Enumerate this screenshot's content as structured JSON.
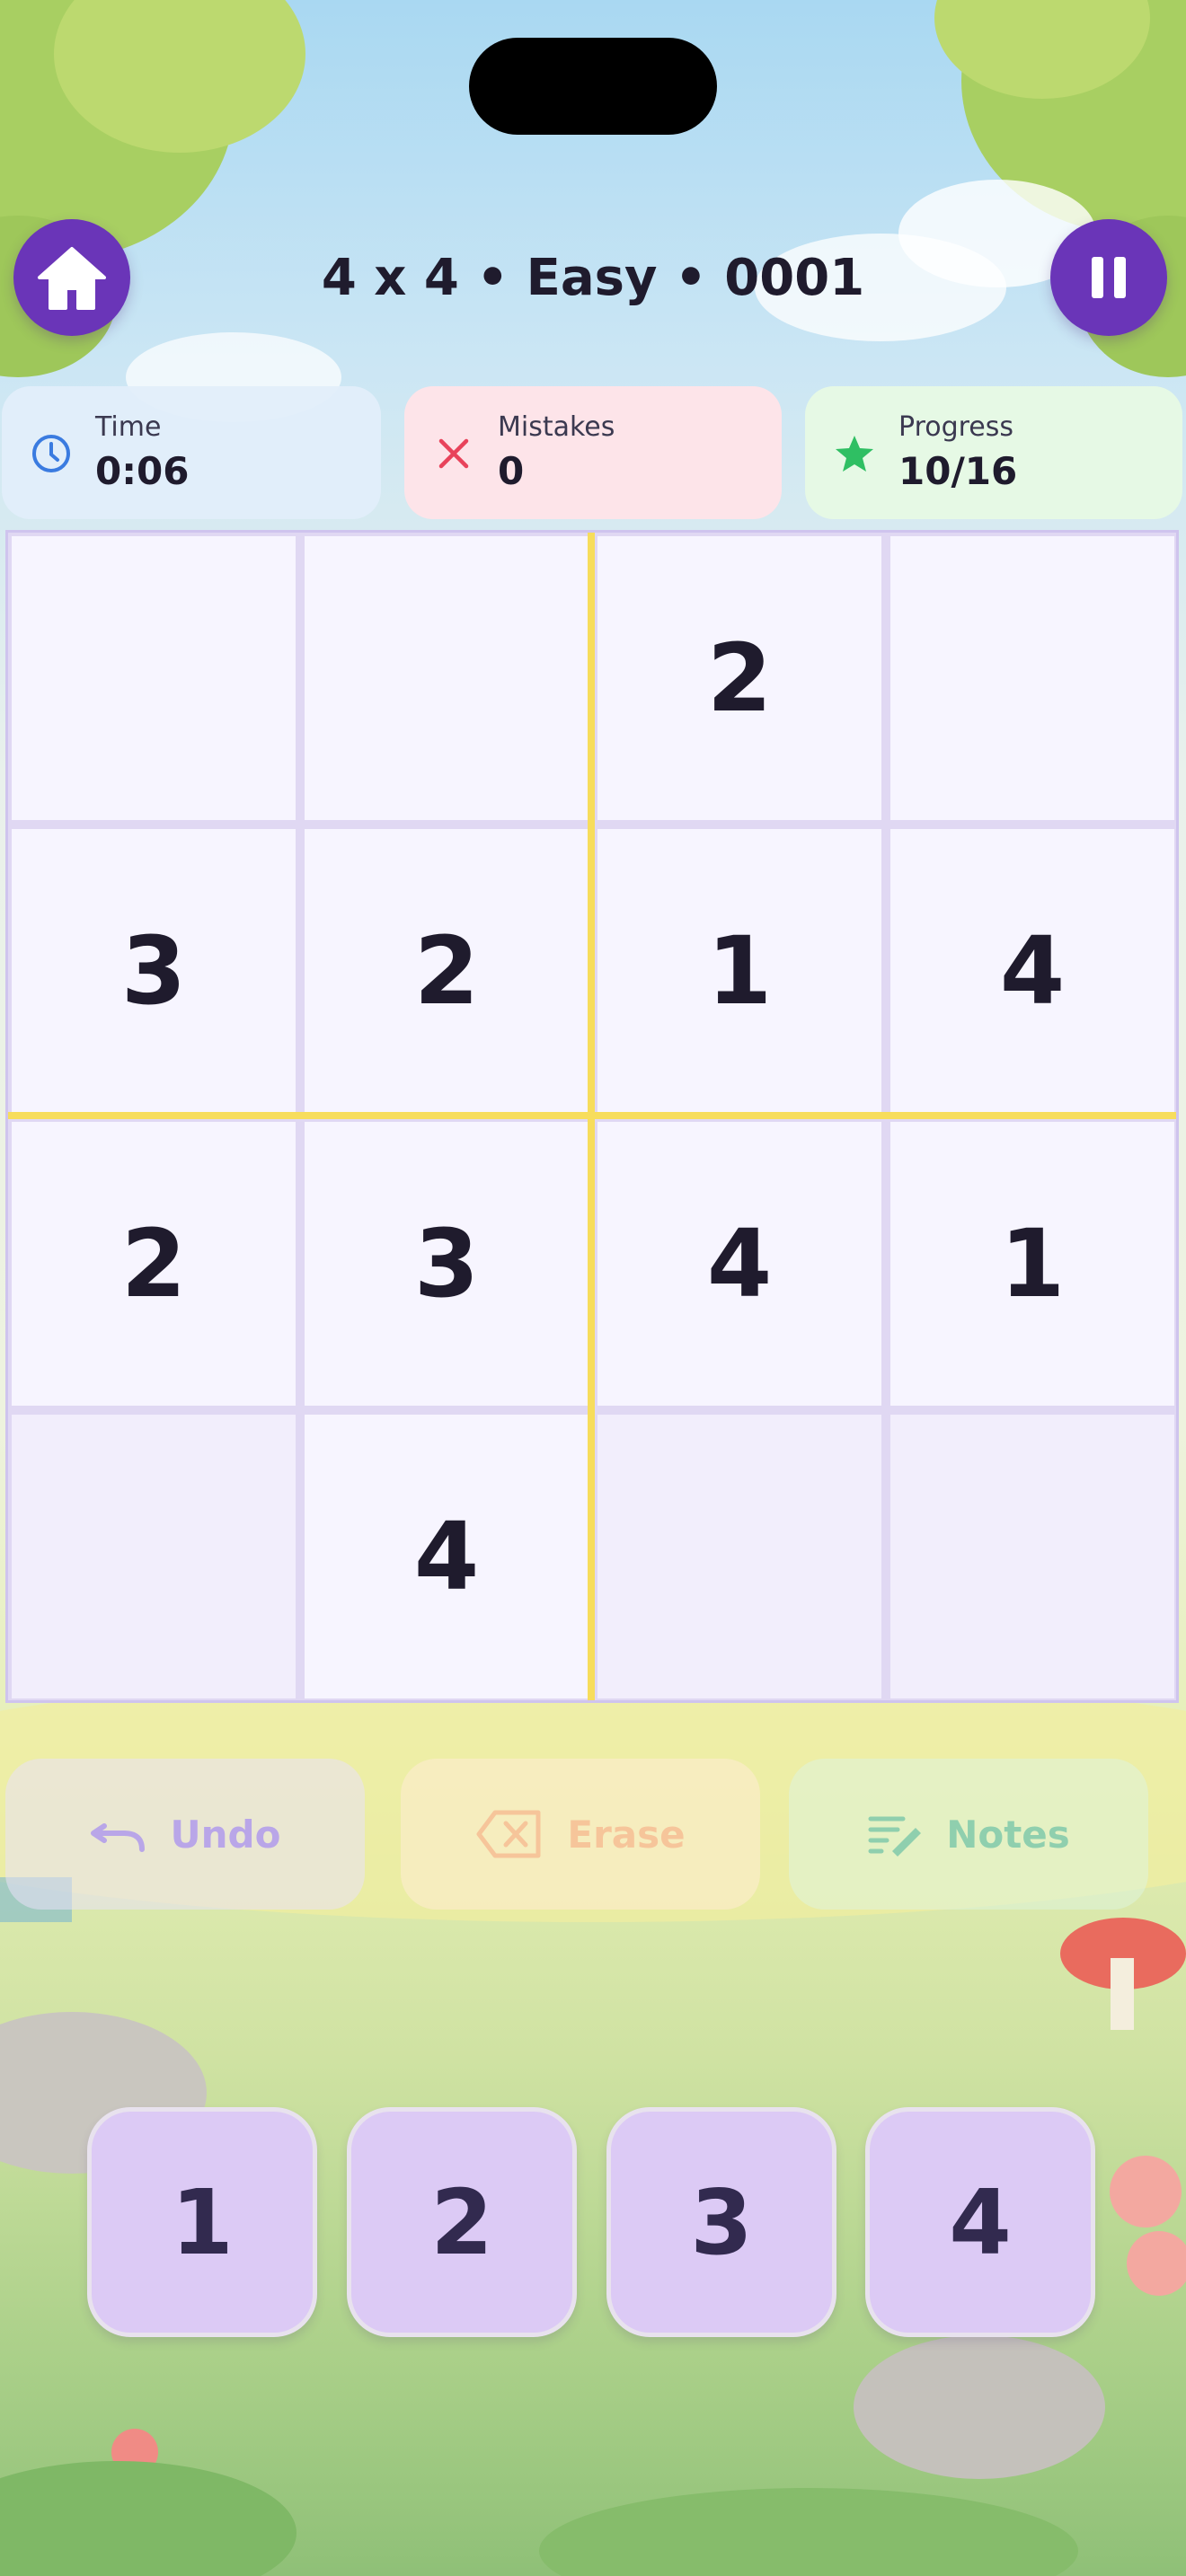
{
  "header": {
    "title": "4 x 4 • Easy • 0001",
    "home_icon": "home-icon",
    "pause_icon": "pause-icon",
    "accent_color": "#6a35b8"
  },
  "stats": {
    "time": {
      "label": "Time",
      "value": "0:06",
      "icon": "clock-icon",
      "color": "#3a7be0"
    },
    "mistakes": {
      "label": "Mistakes",
      "value": "0",
      "icon": "x-icon",
      "color": "#e8435b"
    },
    "progress": {
      "label": "Progress",
      "value": "10/16",
      "icon": "star-icon",
      "color": "#2fbf63"
    }
  },
  "board": {
    "size": 4,
    "cells": [
      [
        "",
        "",
        "2",
        ""
      ],
      [
        "3",
        "2",
        "1",
        "4"
      ],
      [
        "2",
        "3",
        "4",
        "1"
      ],
      [
        "",
        "4",
        "",
        ""
      ]
    ]
  },
  "actions": {
    "undo": {
      "label": "Undo",
      "icon": "undo-icon"
    },
    "erase": {
      "label": "Erase",
      "icon": "erase-icon"
    },
    "notes": {
      "label": "Notes",
      "icon": "notes-icon"
    }
  },
  "numpad": {
    "keys": [
      "1",
      "2",
      "3",
      "4"
    ]
  }
}
